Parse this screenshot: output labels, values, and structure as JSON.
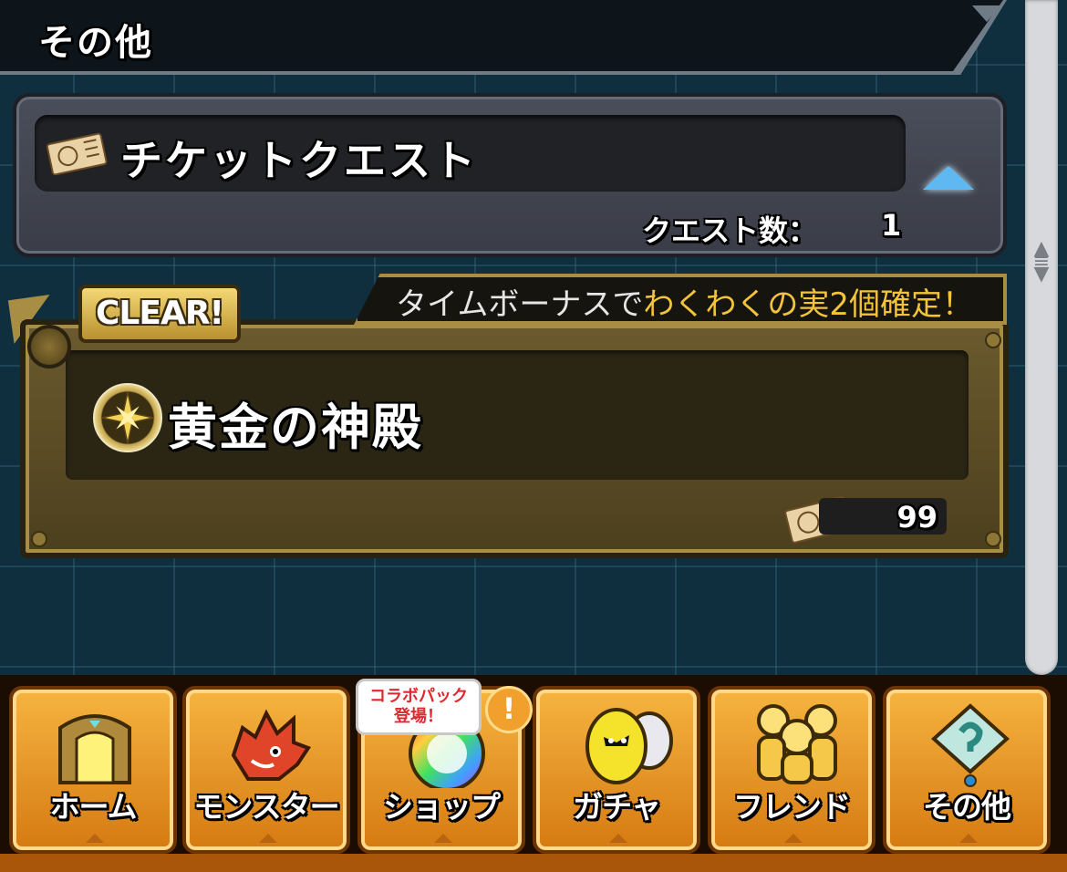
{
  "header": {
    "title": "その他"
  },
  "ticket_quest": {
    "title": "チケットクエスト",
    "quest_count_label": "クエスト数：",
    "quest_count_value": "1"
  },
  "quest_card": {
    "badge": "CLEAR!",
    "bonus_prefix": "タイムボーナスで",
    "bonus_highlight": "わくわくの実2個確定！",
    "title": "黄金の神殿",
    "ticket_cost": "99"
  },
  "nav": {
    "items": [
      {
        "label": "ホーム",
        "icon": "home-gate-icon"
      },
      {
        "label": "モンスター",
        "icon": "monster-icon"
      },
      {
        "label": "ショップ",
        "icon": "rainbow-orb-icon"
      },
      {
        "label": "ガチャ",
        "icon": "egg-icon"
      },
      {
        "label": "フレンド",
        "icon": "friends-icon"
      },
      {
        "label": "その他",
        "icon": "question-sign-icon"
      }
    ],
    "shop_bubble_line1": "コラボパック",
    "shop_bubble_line2": "登場！",
    "alert_symbol": "!"
  },
  "colors": {
    "background": "#0f2f3e",
    "gold": "#a88d45",
    "highlight": "#f3c33a",
    "nav_orange": "#f6b440",
    "arrow_blue": "#5fb8f2"
  }
}
